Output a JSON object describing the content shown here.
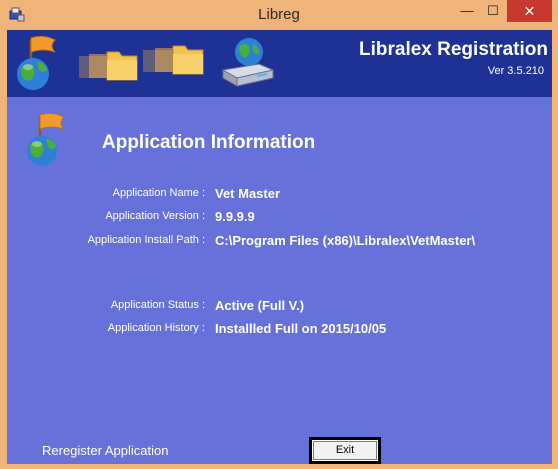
{
  "window": {
    "title": "Libreg"
  },
  "titlebar": {
    "minimize_symbol": "—",
    "maximize_symbol": "☐",
    "close_symbol": "✕"
  },
  "banner": {
    "title": "Libralex Registration",
    "version": "Ver 3.5.210",
    "icons": [
      "globe-flag-icon",
      "folder-icon",
      "folder-icon",
      "server-globe-icon"
    ]
  },
  "section": {
    "title": "Application Information",
    "icon": "globe-flag-icon"
  },
  "info": {
    "name_label": "Application Name :",
    "name_value": "Vet Master",
    "version_label": "Application Version :",
    "version_value": "9.9.9.9",
    "path_label": "Application Install Path :",
    "path_value": "C:\\Program Files (x86)\\Libralex\\VetMaster\\",
    "status_label": "Application Status :",
    "status_value": "Active (Full V.)",
    "history_label": "Application History :",
    "history_value": "Installled Full on 2015/10/05"
  },
  "footer": {
    "reregister_label": "Reregister Application",
    "exit_label": "Exit"
  },
  "colors": {
    "titlebar": "#f0b37a",
    "banner": "#1d3294",
    "client": "#6672d9",
    "close_button": "#c7382f"
  }
}
